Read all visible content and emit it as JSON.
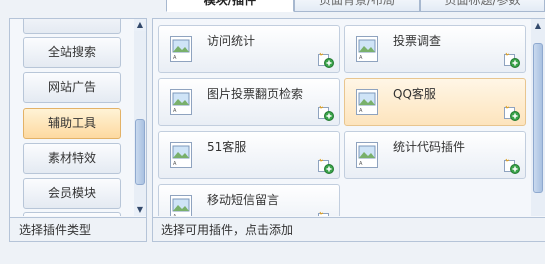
{
  "tabs": [
    {
      "label": "模块/插件",
      "active": true
    },
    {
      "label": "页面背景/布局",
      "active": false
    },
    {
      "label": "页面标题/参数",
      "active": false
    }
  ],
  "sidebar": {
    "categories": [
      {
        "label": "",
        "active": false
      },
      {
        "label": "全站搜索",
        "active": false
      },
      {
        "label": "网站广告",
        "active": false
      },
      {
        "label": "辅助工具",
        "active": true
      },
      {
        "label": "素材特效",
        "active": false
      },
      {
        "label": "会员模块",
        "active": false
      },
      {
        "label": "",
        "active": false
      }
    ],
    "footer": "选择插件类型"
  },
  "main": {
    "plugins": [
      {
        "label": "访问统计",
        "active": false
      },
      {
        "label": "投票调查",
        "active": false
      },
      {
        "label": "图片投票翻页检索",
        "active": false
      },
      {
        "label": "QQ客服",
        "active": true
      },
      {
        "label": "51客服",
        "active": false
      },
      {
        "label": "统计代码插件",
        "active": false
      },
      {
        "label": "移动短信留言",
        "active": false
      }
    ],
    "footer": "选择可用插件，点击添加"
  },
  "colors": {
    "accent_active": "#fdd9a0",
    "panel_bg": "#f4f7fb",
    "border": "#b5c4d8"
  }
}
